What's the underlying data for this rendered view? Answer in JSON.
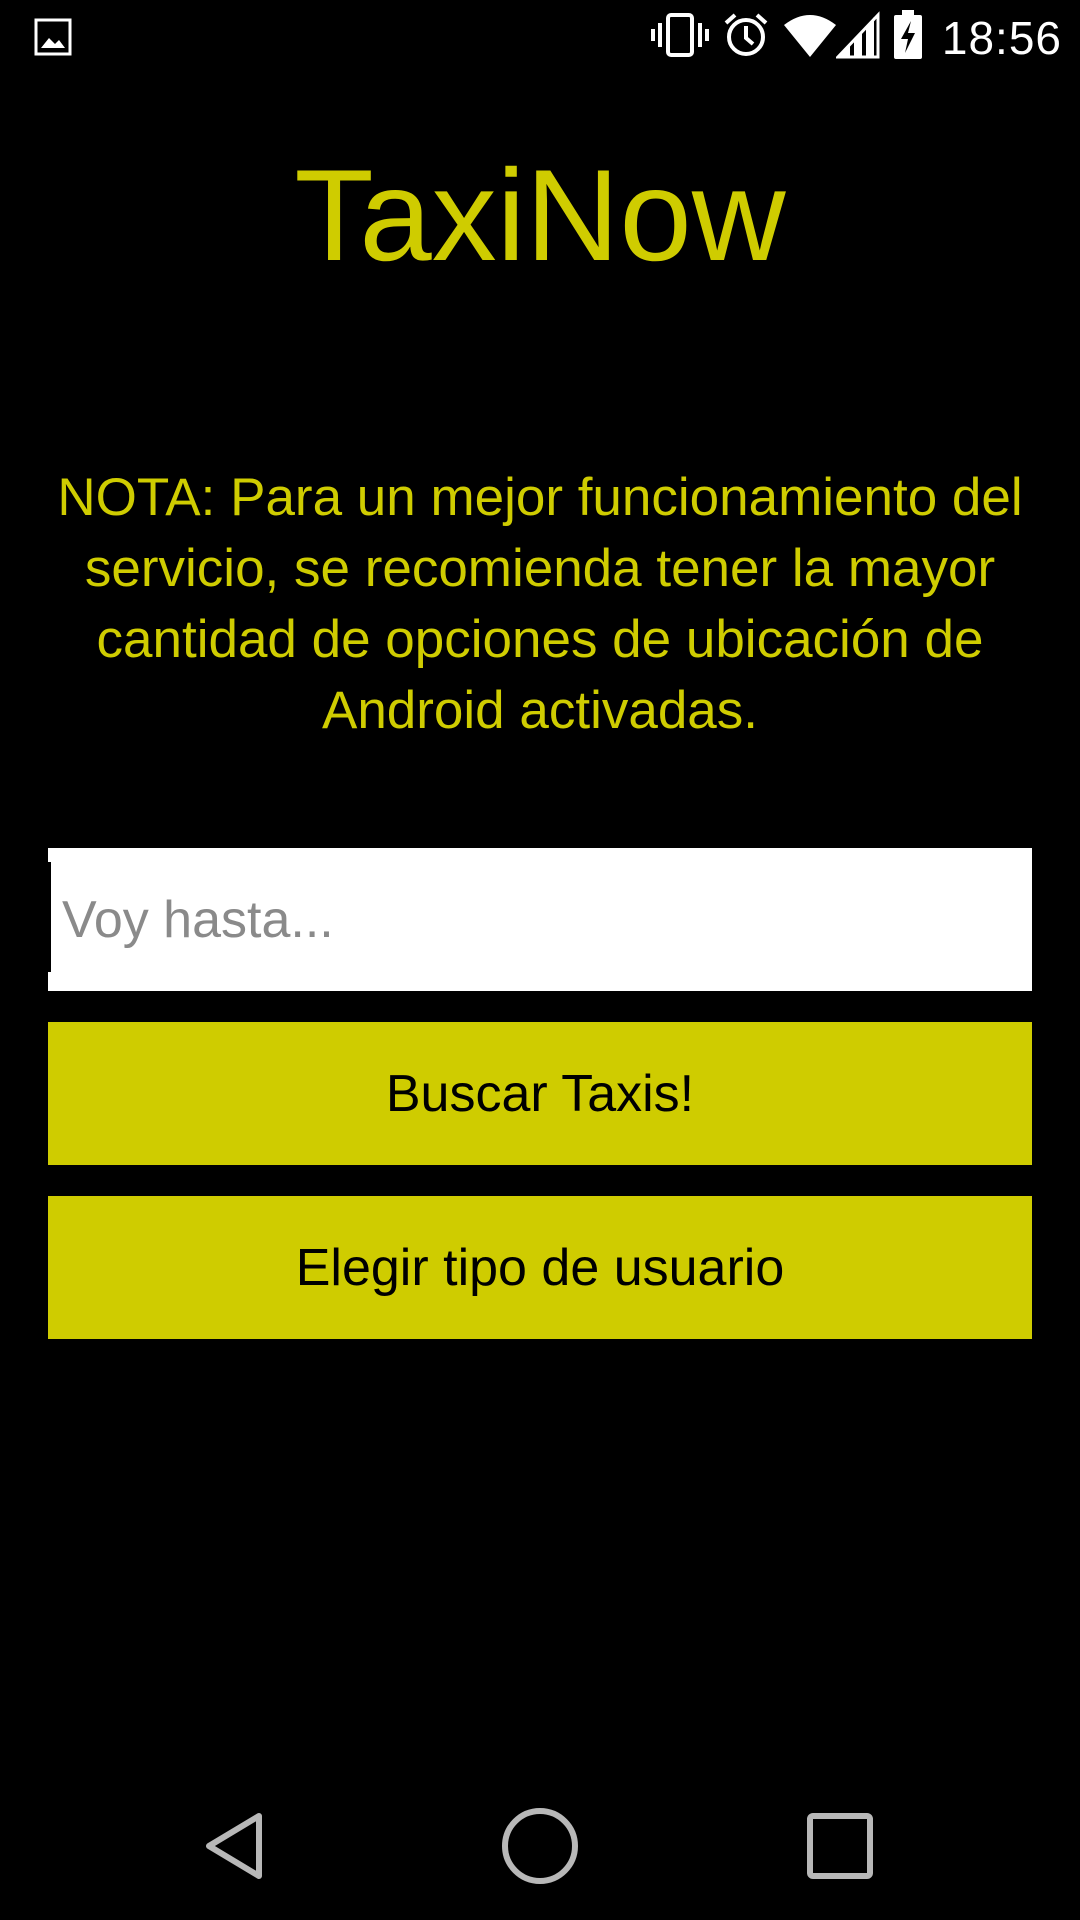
{
  "status_bar": {
    "time": "18:56",
    "icons": [
      "image-icon",
      "vibrate-icon",
      "alarm-icon",
      "wifi-icon",
      "signal-icon",
      "battery-charging-icon"
    ],
    "icon_color": "#ffffff"
  },
  "app": {
    "title": "TaxiNow",
    "note": "NOTA: Para un mejor funcionamiento del servicio, se recomienda tener la mayor cantidad de opciones de ubicación de Android activadas.",
    "accent_color": "#cfcc00",
    "background_color": "#000000"
  },
  "destination": {
    "placeholder": "Voy hasta...",
    "value": ""
  },
  "buttons": {
    "search_label": "Buscar Taxis!",
    "user_type_label": "Elegir tipo de usuario"
  },
  "nav_bar": {
    "icons": [
      "back-icon",
      "home-icon",
      "recents-icon"
    ]
  }
}
